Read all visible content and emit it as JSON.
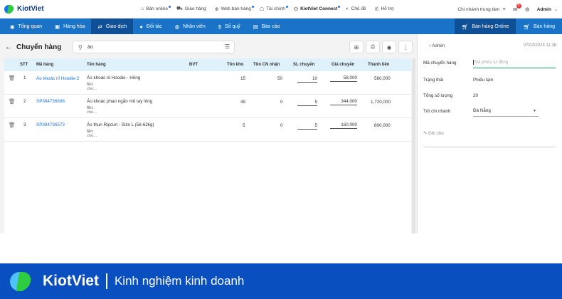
{
  "app": {
    "brand": "KiotViet"
  },
  "topbar": {
    "links": [
      {
        "label": "Bán online",
        "icon": "store-icon",
        "dot": true
      },
      {
        "label": "Giao hàng",
        "icon": "truck-icon",
        "dot": false
      },
      {
        "label": "Web bán hàng",
        "icon": "globe-icon",
        "dot": true
      },
      {
        "label": "Tài chính",
        "icon": "finance-icon",
        "dot": true
      },
      {
        "label": "KiotViet Connect",
        "icon": "connect-icon",
        "dot": true
      },
      {
        "label": "Chủ đề",
        "icon": "palette-icon",
        "dot": false
      },
      {
        "label": "Hỗ trợ",
        "icon": "support-icon",
        "dot": false
      }
    ],
    "branch": "Chi nhánh trung tâm",
    "notification_count": "0",
    "user": "Admin"
  },
  "nav": {
    "items": [
      {
        "label": "Tổng quan",
        "icon": "eye-icon"
      },
      {
        "label": "Hàng hóa",
        "icon": "box-icon"
      },
      {
        "label": "Giao dịch",
        "icon": "exchange-icon"
      },
      {
        "label": "Đối tác",
        "icon": "user-icon"
      },
      {
        "label": "Nhân viên",
        "icon": "users-icon"
      },
      {
        "label": "Sổ quỹ",
        "icon": "cash-icon"
      },
      {
        "label": "Báo cáo",
        "icon": "chart-icon"
      }
    ],
    "active_index": 2,
    "online_sales": "Bán hàng Online",
    "sales": "Bán hàng"
  },
  "page": {
    "title": "Chuyển hàng",
    "search_value": "áo"
  },
  "table": {
    "headers": {
      "stt": "STT",
      "code": "Mã hàng",
      "name": "Tên hàng",
      "unit": "ĐVT",
      "stock": "Tồn kho",
      "branch_stock": "Tồn CN nhận",
      "qty": "SL chuyển",
      "price": "Giá chuyển",
      "total": "Thành tiền"
    },
    "rows": [
      {
        "stt": "1",
        "code": "Áo khoác nỉ Hoodie-2",
        "name": "Áo khoác nỉ Hoodie - Hồng",
        "note": "Ghi chú...",
        "unit": "",
        "stock": "15",
        "branch_stock": "50",
        "qty": "10",
        "price": "58,000",
        "total": "580,000"
      },
      {
        "stt": "2",
        "code": "SP384736608",
        "name": "Áo khoác phao ngắn mũ tay lông",
        "note": "Ghi chú...",
        "unit": "",
        "stock": "49",
        "branch_stock": "0",
        "qty": "5",
        "price": "344,000",
        "total": "1,720,000"
      },
      {
        "stt": "3",
        "code": "SP384736573",
        "name": "Áo thun Ripcurl - Size L (56-62kg)",
        "note": "Ghi chú...",
        "unit": "",
        "stock": "5",
        "branch_stock": "0",
        "qty": "5",
        "price": "160,000",
        "total": "800,000"
      }
    ]
  },
  "side": {
    "user": "Admin",
    "date": "07/02/2023 11:38",
    "code_label": "Mã chuyển hàng",
    "code_placeholder": "Mã phiếu tự động",
    "status_label": "Trạng thái",
    "status_value": "Phiếu tạm",
    "total_qty_label": "Tổng số lượng",
    "total_qty_value": "20",
    "to_branch_label": "Tới chi nhánh",
    "to_branch_value": "Đà Nẵng",
    "note_placeholder": "Ghi chú"
  },
  "footer": {
    "brand": "KiotViet",
    "tagline": "Kinh nghiệm kinh doanh"
  }
}
